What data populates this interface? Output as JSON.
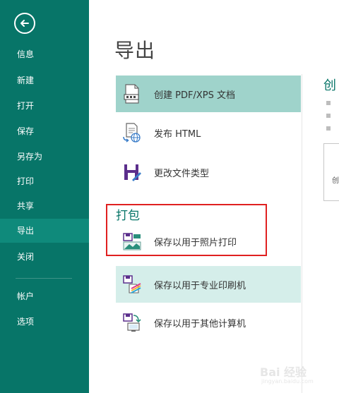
{
  "sidebar": {
    "items": [
      {
        "label": "信息"
      },
      {
        "label": "新建"
      },
      {
        "label": "打开"
      },
      {
        "label": "保存"
      },
      {
        "label": "另存为"
      },
      {
        "label": "打印"
      },
      {
        "label": "共享"
      },
      {
        "label": "导出",
        "selected": true
      },
      {
        "label": "关闭"
      },
      {
        "label": "帐户"
      },
      {
        "label": "选项"
      }
    ]
  },
  "main": {
    "title": "导出",
    "options": [
      {
        "label": "创建 PDF/XPS 文档",
        "icon": "pdf-document-icon"
      },
      {
        "label": "发布 HTML",
        "icon": "publish-html-icon"
      },
      {
        "label": "更改文件类型",
        "icon": "change-file-type-icon"
      }
    ],
    "pack_section": {
      "title": "打包",
      "options": [
        {
          "label": "保存以用于照片打印",
          "icon": "photo-print-icon"
        },
        {
          "label": "保存以用于专业印刷机",
          "icon": "commercial-printer-icon"
        },
        {
          "label": "保存以用于其他计算机",
          "icon": "other-computer-icon"
        }
      ]
    }
  },
  "right_pane": {
    "title": "创",
    "button_label": "创"
  },
  "watermark": {
    "text": "Bai 经验",
    "sub": "jingyan.baidu.com"
  },
  "colors": {
    "sidebar": "#077568",
    "sidebar_selected": "#0f8a7b",
    "active_option": "#9fd3cb",
    "hover_option": "#d5eeea",
    "highlight_box": "#e02020"
  }
}
